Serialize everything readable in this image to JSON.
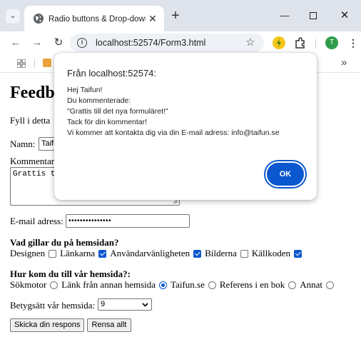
{
  "browser": {
    "tab_title": "Radio buttons & Drop-down lis",
    "url": "localhost:52574/Form3.html",
    "avatar_letter": "T",
    "accent_color": "#0b57d0"
  },
  "page": {
    "title": "Feedb",
    "intro": "Fyll i detta",
    "name_label": "Namn:",
    "name_value": "Taifu",
    "comment_label": "Kommentar",
    "comment_value": "Grattis ti",
    "email_label": "E-mail adress:",
    "email_value": "•••••••••••••••",
    "like_question": "Vad gillar du på hemsidan?",
    "like_options": [
      {
        "label": "Designen",
        "checked": false
      },
      {
        "label": "Länkarna",
        "checked": true
      },
      {
        "label": "Användarvänligheten",
        "checked": true
      },
      {
        "label": "Bilderna",
        "checked": false
      },
      {
        "label": "Källkoden",
        "checked": true
      }
    ],
    "source_question": "Hur kom du till vår hemsida?:",
    "source_options": [
      {
        "label": "Sökmotor",
        "selected": false
      },
      {
        "label": "Länk från annan hemsida",
        "selected": true
      },
      {
        "label": "Taifun.se",
        "selected": false
      },
      {
        "label": "Referens i en bok",
        "selected": false
      },
      {
        "label": "Annat",
        "selected": false
      }
    ],
    "rating_label": "Betygsätt vår hemsida:",
    "rating_value": "9",
    "submit_label": "Skicka din respons",
    "reset_label": "Rensa allt"
  },
  "dialog": {
    "title": "Från localhost:52574:",
    "lines": [
      "Hej Taifun!",
      "Du kommenterade:",
      "\"Grattis till det nya formuläret!\"",
      "Tack för din kommentar!",
      "Vi kommer att kontakta dig via din E-mail adress: info@taifun.se"
    ],
    "ok_label": "OK"
  }
}
